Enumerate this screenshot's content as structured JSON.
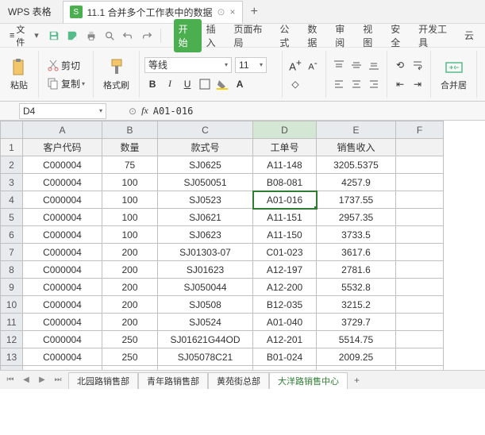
{
  "title_bar": {
    "app": "WPS 表格",
    "doc": "11.1 合并多个工作表中的数据",
    "close": "×",
    "plus": "+",
    "doc_icon": "S"
  },
  "qat": {
    "file": "文件",
    "dd": "▾"
  },
  "menu": [
    "开始",
    "插入",
    "页面布局",
    "公式",
    "数据",
    "审阅",
    "视图",
    "安全",
    "开发工具",
    "云"
  ],
  "clip": {
    "cut": "剪切",
    "copy": "复制",
    "paste": "粘贴",
    "brush": "格式刷",
    "dd": "▾"
  },
  "font": {
    "name": "等线",
    "size": "11",
    "bold": "B",
    "italic": "I",
    "under": "U",
    "dd": "▾"
  },
  "fsize": {
    "grow": "A",
    "shrink": "A"
  },
  "align": {
    "merge": "合并居"
  },
  "formula": {
    "cell": "D4",
    "fx": "fx",
    "value": "A01-016",
    "dd": "▾"
  },
  "cols": [
    "",
    "A",
    "B",
    "C",
    "D",
    "E",
    "F"
  ],
  "widths": [
    28,
    100,
    70,
    120,
    80,
    100,
    60
  ],
  "active": {
    "r": 4,
    "c": 4
  },
  "header_row": [
    "客户代码",
    "数量",
    "款式号",
    "工单号",
    "销售收入",
    ""
  ],
  "rows": [
    [
      "C000004",
      "75",
      "SJ0625",
      "A11-148",
      "3205.5375",
      ""
    ],
    [
      "C000004",
      "100",
      "SJ050051",
      "B08-081",
      "4257.9",
      ""
    ],
    [
      "C000004",
      "100",
      "SJ0523",
      "A01-016",
      "1737.55",
      ""
    ],
    [
      "C000004",
      "100",
      "SJ0621",
      "A11-151",
      "2957.35",
      ""
    ],
    [
      "C000004",
      "100",
      "SJ0623",
      "A11-150",
      "3733.5",
      ""
    ],
    [
      "C000004",
      "200",
      "SJ01303-07",
      "C01-023",
      "3617.6",
      ""
    ],
    [
      "C000004",
      "200",
      "SJ01623",
      "A12-197",
      "2781.6",
      ""
    ],
    [
      "C000004",
      "200",
      "SJ050044",
      "A12-200",
      "5532.8",
      ""
    ],
    [
      "C000004",
      "200",
      "SJ0508",
      "B12-035",
      "3215.2",
      ""
    ],
    [
      "C000004",
      "200",
      "SJ0524",
      "A01-040",
      "3729.7",
      ""
    ],
    [
      "C000004",
      "250",
      "SJ01621G44OD",
      "A12-201",
      "5514.75",
      ""
    ],
    [
      "C000004",
      "250",
      "SJ05078C21",
      "B01-024",
      "2009.25",
      ""
    ],
    [
      "",
      "",
      "",
      "",
      "",
      ""
    ]
  ],
  "sheets": {
    "nav": [
      "⏮",
      "◀",
      "▶",
      "⏭"
    ],
    "tabs": [
      "北园路销售部",
      "青年路销售部",
      "黄苑街总部",
      "大洋路销售中心"
    ],
    "active": 3,
    "plus": "+"
  }
}
